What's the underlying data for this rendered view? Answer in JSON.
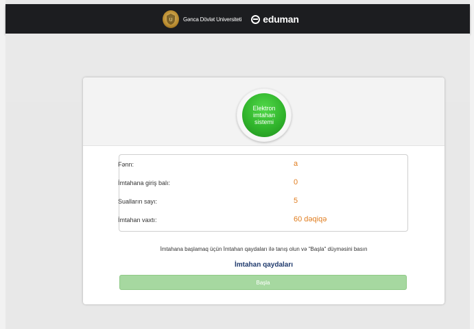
{
  "header": {
    "university_name": "Gənca Dövlət Universiteti",
    "brand": "eduman",
    "university_logo_icon": "university-seal-icon",
    "brand_icon": "eduman-logo-icon"
  },
  "badge": {
    "lines": [
      "Elektron",
      "imtahan",
      "sistemi"
    ],
    "color": "#31b52c"
  },
  "exam_info": {
    "rows": [
      {
        "label": "Fənn:",
        "value": "a"
      },
      {
        "label": "İmtahana giriş balı:",
        "value": "0"
      },
      {
        "label": "Sualların sayı:",
        "value": "5"
      },
      {
        "label": "İmtahan vaxtı:",
        "value": "60 dəqiqə"
      }
    ],
    "value_color": "#e07d1f"
  },
  "instruction": "İmtahana başlamaq üçün İmtahan qaydaları ilə tanış olun və \"Başla\" düyməsini basın",
  "rules_link": "İmtahan qaydaları",
  "start_button": {
    "label": "Başla",
    "state": "disabled",
    "color": "#a6d8a0"
  }
}
